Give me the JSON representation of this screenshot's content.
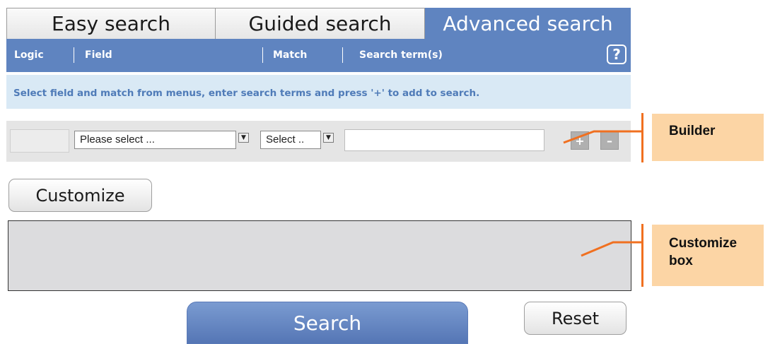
{
  "tabs": [
    {
      "label": "Easy search",
      "active": false
    },
    {
      "label": "Guided search",
      "active": false
    },
    {
      "label": "Advanced search",
      "active": true
    }
  ],
  "header": {
    "logic": "Logic",
    "field": "Field",
    "match": "Match",
    "search_terms": "Search term(s)",
    "help": "?"
  },
  "info_text": "Select field and match from menus, enter search terms and press '+' to add to search.",
  "builder": {
    "field_select": "Please select ...",
    "match_select": "Select ..",
    "search_term_value": "",
    "add_label": "+",
    "remove_label": "–"
  },
  "customize": {
    "button_label": "Customize"
  },
  "actions": {
    "search_label": "Search",
    "reset_label": "Reset"
  },
  "callouts": {
    "builder": "Builder",
    "customize_line1": "Customize",
    "customize_line2": "box"
  },
  "colors": {
    "header_blue": "#5f84c0",
    "info_bg": "#d9e9f5",
    "info_text": "#4f7bb8",
    "callout_bg": "#fcd5a5",
    "callout_line": "#f07020"
  }
}
